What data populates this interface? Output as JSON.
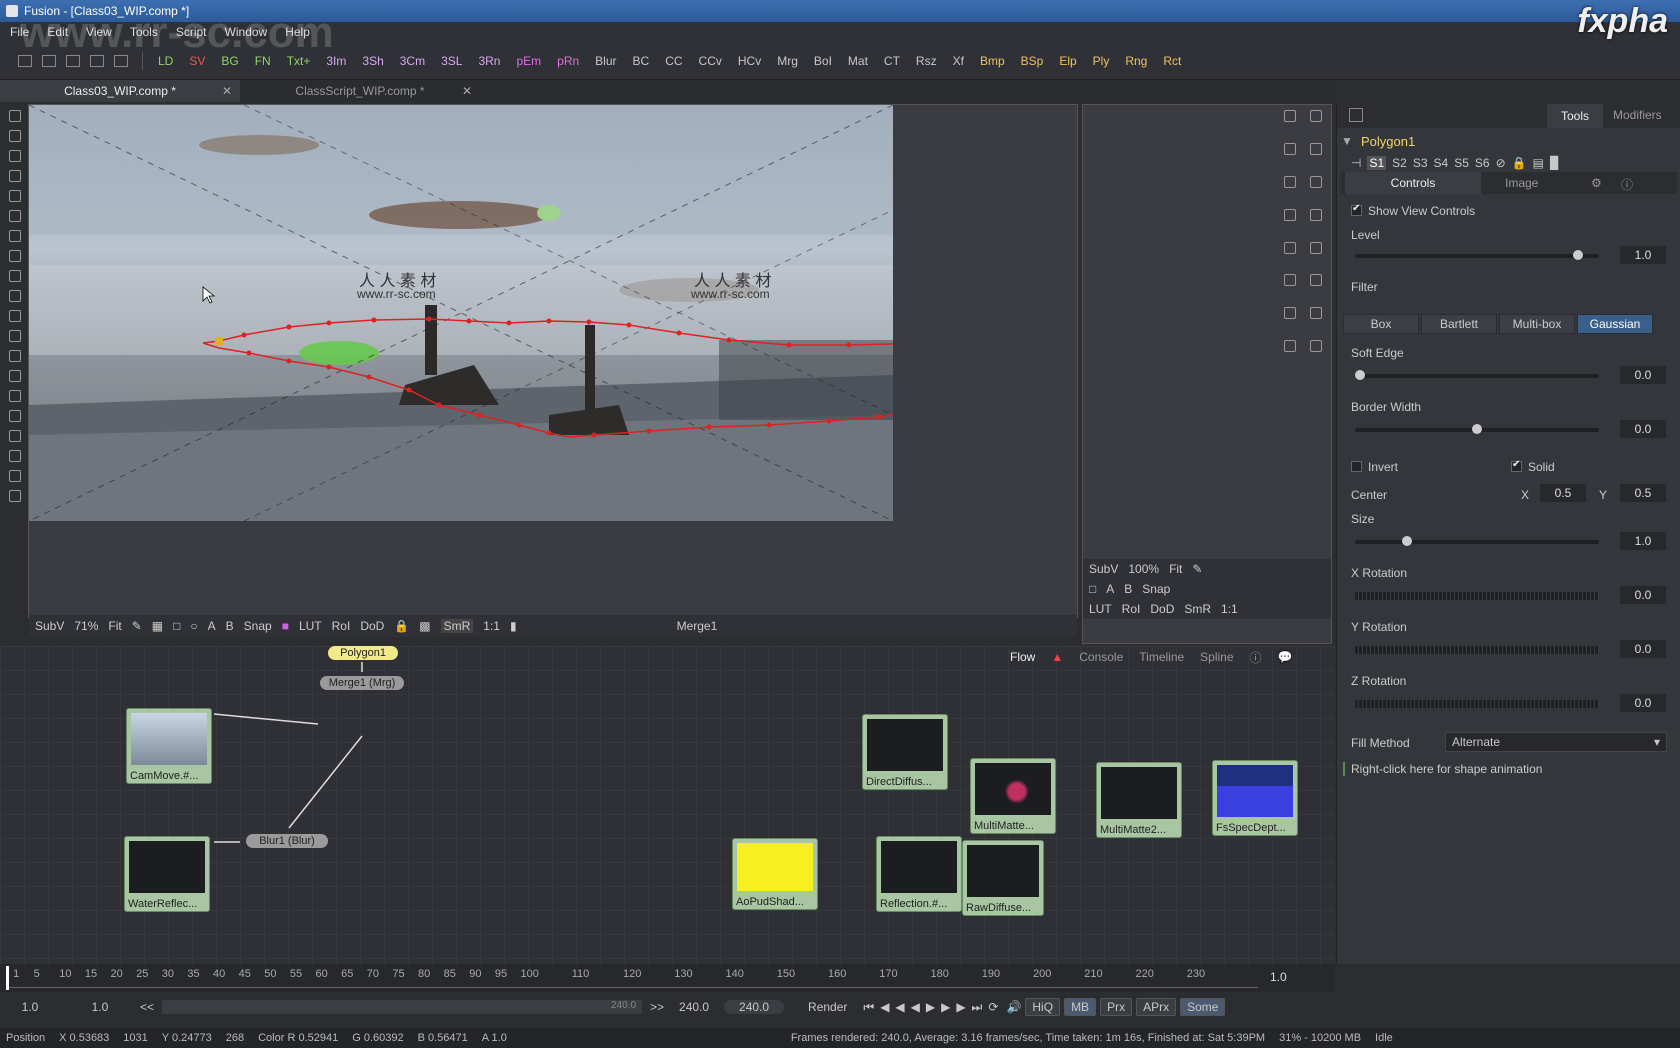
{
  "window": {
    "title": "Fusion - [Class03_WIP.comp *]",
    "logo": "fxpha"
  },
  "menu": [
    "File",
    "Edit",
    "View",
    "Tools",
    "Script",
    "Window",
    "Help"
  ],
  "toolbar": {
    "buttons": [
      "LD",
      "SV",
      "BG",
      "FN",
      "Txt+",
      "3Im",
      "3Sh",
      "3Cm",
      "3SL",
      "3Rn",
      "pEm",
      "pRn",
      "Blur",
      "BC",
      "CC",
      "CCv",
      "HCv",
      "Mrg",
      "BoI",
      "Mat",
      "CT",
      "Rsz",
      "Xf",
      "Bmp",
      "BSp",
      "Elp",
      "Ply",
      "Rng",
      "Rct"
    ],
    "colors": {
      "LD": "#8fd46b",
      "SV": "#e25a5a",
      "BG": "#8fd46b",
      "FN": "#8fd46b",
      "Txt+": "#8fd46b",
      "3Im": "#d7a8f0",
      "3Sh": "#d7a8f0",
      "3Cm": "#d7a8f0",
      "3SL": "#d7a8f0",
      "3Rn": "#d7a8f0",
      "pEm": "#e070e0",
      "pRn": "#e070e0",
      "Ply": "#f0c060",
      "Bmp": "#f0c060",
      "BSp": "#f0c060",
      "Elp": "#f0c060",
      "Rng": "#f0c060",
      "Rct": "#f0c060"
    }
  },
  "tabs": [
    {
      "label": "Class03_WIP.comp *"
    },
    {
      "label": "ClassScript_WIP.comp *"
    }
  ],
  "watermark": "www.rr-sc.com",
  "viewer1": {
    "overlay1": "人 人 素 材",
    "overlay1sub": "www.rr-sc.com",
    "overlay2": "人 人 素 材",
    "overlay2sub": "www.rr-sc.com",
    "bar": [
      "SubV",
      "71%",
      "Fit",
      "Snap",
      "LUT",
      "RoI",
      "DoD",
      "SmR",
      "1:1"
    ],
    "name": "Merge1"
  },
  "viewer2": {
    "bar1": [
      "SubV",
      "100%",
      "Fit"
    ],
    "bar2": [
      "Snap"
    ],
    "bar3": [
      "LUT",
      "RoI",
      "DoD",
      "SmR",
      "1:1"
    ]
  },
  "inspector": {
    "tabs": [
      "Tools",
      "Modifiers"
    ],
    "tool": "Polygon1",
    "sets": [
      "S1",
      "S2",
      "S3",
      "S4",
      "S5",
      "S6"
    ],
    "subtabs": [
      "Controls",
      "Image"
    ],
    "show_view_controls": "Show View Controls",
    "level_label": "Level",
    "level_value": "1.0",
    "level_fraction": 0.93,
    "filter_label": "Filter",
    "filters": [
      "Box",
      "Bartlett",
      "Multi-box",
      "Gaussian"
    ],
    "filter_selected": "Gaussian",
    "soft_edge_label": "Soft Edge",
    "soft_edge_value": "0.0",
    "border_width_label": "Border Width",
    "border_width_value": "0.0",
    "border_fraction": 0.5,
    "invert_label": "Invert",
    "solid_label": "Solid",
    "center_label": "Center",
    "center_x_label": "X",
    "center_x": "0.5",
    "center_y_label": "Y",
    "center_y": "0.5",
    "size_label": "Size",
    "size_value": "1.0",
    "size_fraction": 0.2,
    "xrot_label": "X Rotation",
    "xrot_value": "0.0",
    "yrot_label": "Y Rotation",
    "yrot_value": "0.0",
    "zrot_label": "Z Rotation",
    "zrot_value": "0.0",
    "fill_method_label": "Fill Method",
    "fill_method_value": "Alternate",
    "shape_anim": "Right-click here for shape animation"
  },
  "flow": {
    "tabs": [
      "Flow",
      "Console",
      "Timeline",
      "Spline"
    ],
    "nodes": {
      "cam": "CamMove.#...",
      "water": "WaterReflec...",
      "polygon": "Polygon1",
      "merge": "Merge1 (Mrg)",
      "blur": "Blur1 (Blur)",
      "direct": "DirectDiffus...",
      "mm1": "MultiMatte...",
      "mm2": "MultiMatte2...",
      "fsspec": "FsSpecDept...",
      "aopud": "AoPudShad...",
      "refl": "Reflection.#...",
      "raw": "RawDiffuse..."
    }
  },
  "timeline": {
    "ticks": [
      "1",
      "5",
      "10",
      "15",
      "20",
      "25",
      "30",
      "35",
      "40",
      "45",
      "50",
      "55",
      "60",
      "65",
      "70",
      "75",
      "80",
      "85",
      "90",
      "95",
      "100",
      "110",
      "120",
      "130",
      "140",
      "150",
      "160",
      "170",
      "180",
      "190",
      "200",
      "210",
      "220",
      "230"
    ],
    "end_value": "1.0"
  },
  "transport": {
    "start": "1.0",
    "current": "1.0",
    "range_end": "240.0",
    "end": "240.0",
    "current_time": "240.0",
    "render": "Render",
    "buttons": [
      "HiQ",
      "MB",
      "Prx",
      "APrx",
      "Some"
    ]
  },
  "status": {
    "position": "Position",
    "px": "X 0.53683",
    "pxi": "1031",
    "py": "Y 0.24773",
    "pyi": "268",
    "color": "Color R 0.52941",
    "g": "G 0.60392",
    "b": "B 0.56471",
    "a": "A 1.0",
    "frames": "Frames rendered: 240.0,  Average: 3.16 frames/sec,  Time taken: 1m 16s,  Finished at: Sat 5:39PM",
    "mem": "31% - 10200 MB",
    "state": "Idle"
  }
}
